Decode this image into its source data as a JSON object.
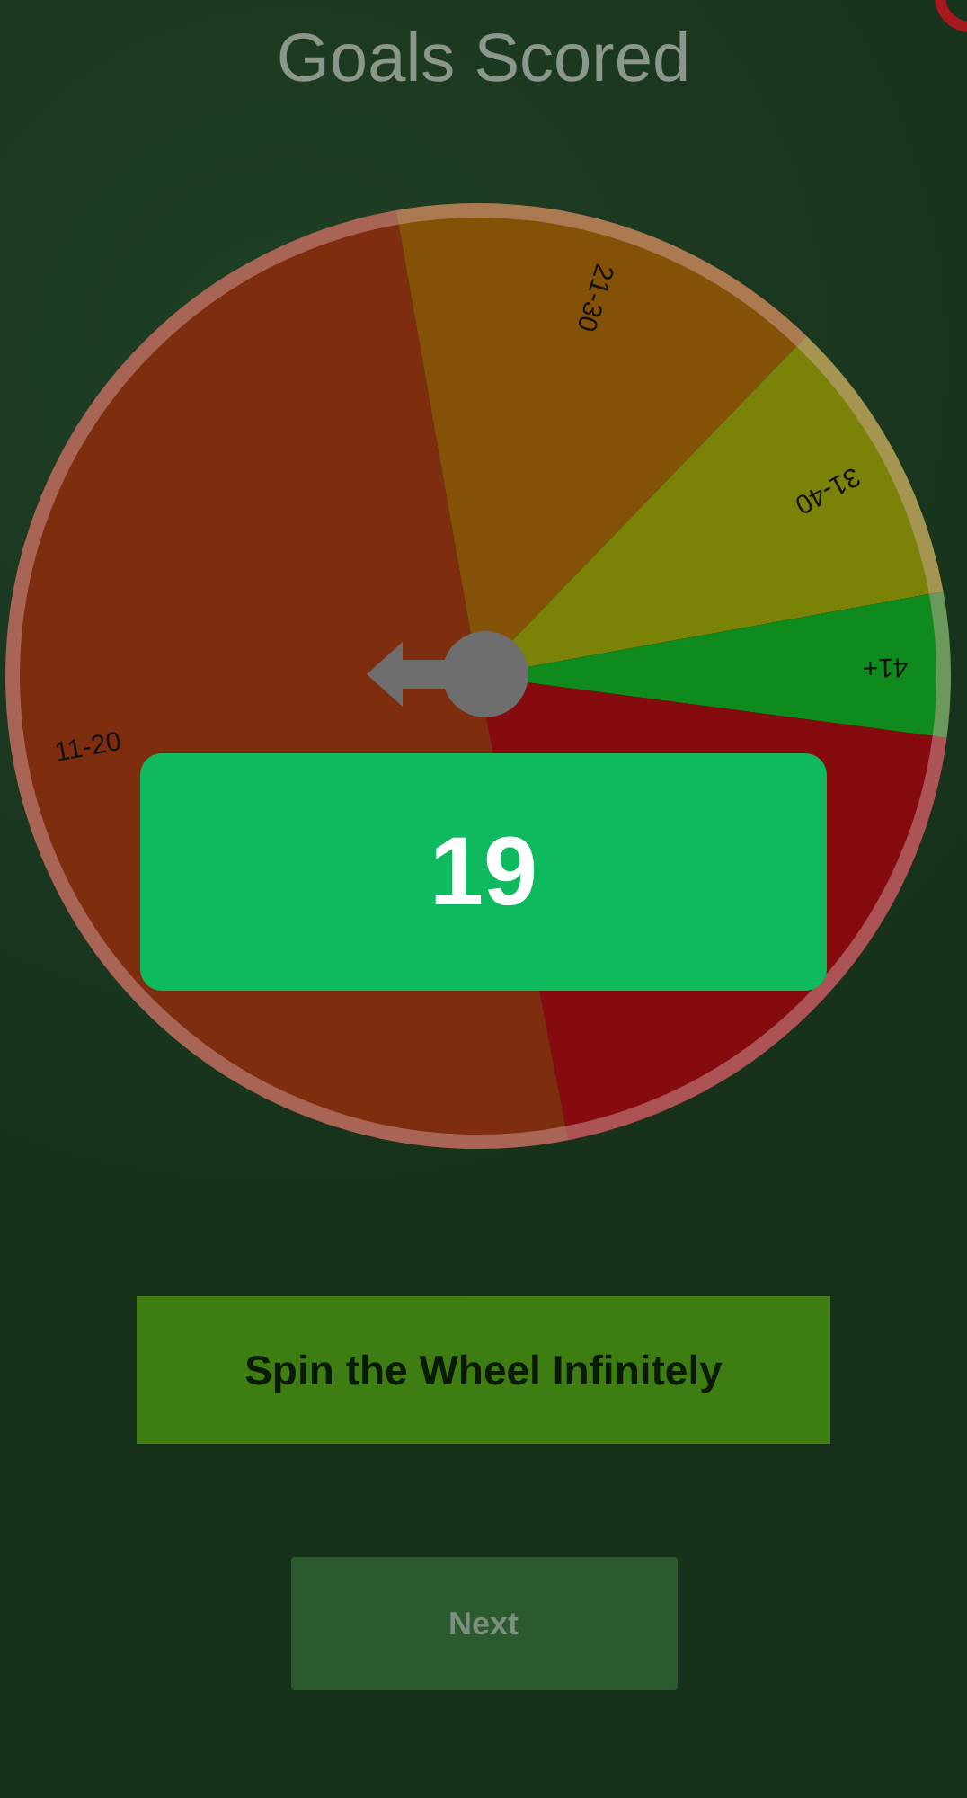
{
  "title": "Goals Scored",
  "wheel": {
    "segments": [
      {
        "label": "21-30",
        "color": "#845207"
      },
      {
        "label": "31-40",
        "color": "#7a8208"
      },
      {
        "label": "41+",
        "color": "#0f8a1c"
      },
      {
        "color": "#850b0f"
      },
      {
        "label": "11-20",
        "color": "#7f2d0f"
      }
    ]
  },
  "result": "19",
  "buttons": [
    {
      "label": "Spin the Wheel Infinitely",
      "kind": "spin"
    },
    {
      "label": "Next",
      "kind": "next",
      "disabled": true
    }
  ]
}
